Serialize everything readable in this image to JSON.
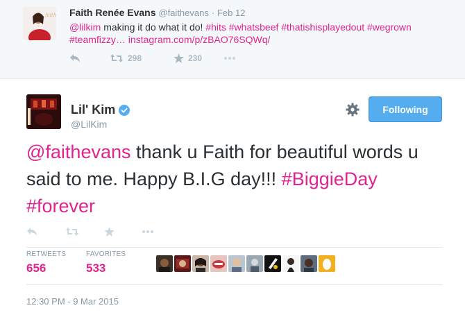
{
  "parent_tweet": {
    "fullname": "Faith Renée Evans",
    "username": "@faithevans",
    "separator": "·",
    "date": "Feb 12",
    "text": {
      "mention": "@lilkim",
      "body": " making it do what it do! ",
      "hashtags_line1": "#hits #whatsbeef #thatishisplayedout #wegrown",
      "hashtags_line2": "#teamfizzy…",
      "link": " instagram.com/p/zBAO76SQWq/"
    },
    "actions": {
      "reply_icon": "reply-icon",
      "retweet_icon": "retweet-icon",
      "retweet_count": "298",
      "favorite_icon": "star-icon",
      "favorite_count": "230",
      "more_icon": "more-icon"
    }
  },
  "main_tweet": {
    "fullname": "Lil' Kim",
    "verified_icon": "verified-badge-icon",
    "username": "@LilKim",
    "settings_icon": "gear-icon",
    "follow_button": "Following",
    "text": {
      "mention": "@faithevans",
      "body": " thank u Faith for beautiful words u said to me. Happy B.I.G day!!! ",
      "hashtag1": "#BiggieDay",
      "hashtag2": "#forever"
    },
    "actions": [
      "reply-icon",
      "retweet-icon",
      "star-icon",
      "more-icon"
    ],
    "stats": {
      "retweets_label": "RETWEETS",
      "retweets_value": "656",
      "favorites_label": "FAVORITES",
      "favorites_value": "533"
    },
    "favorited_by_count": 10,
    "timestamp": "12:30 PM - 9 Mar 2015"
  },
  "colors": {
    "link": "#e0248f",
    "follow_button": "#55acee",
    "muted": "#8899a6",
    "parent_bg": "#f5f8fa"
  }
}
